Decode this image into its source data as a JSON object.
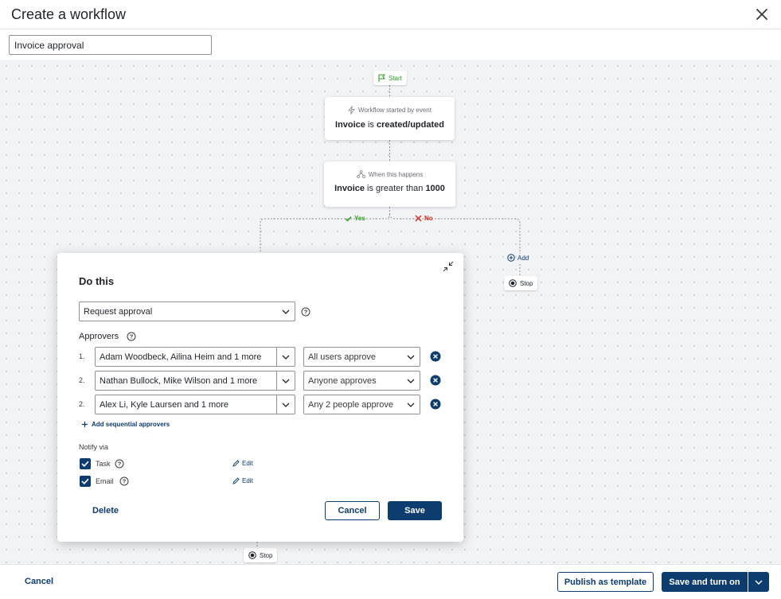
{
  "header": {
    "title": "Create a workflow"
  },
  "workflow_name": {
    "value": "Invoice approval"
  },
  "flow": {
    "start_label": "Start",
    "trigger": {
      "caption": "Workflow started by event",
      "subject": "Invoice",
      "verb": "is",
      "event": "created/updated"
    },
    "condition": {
      "caption": "When this happens",
      "subject": "Invoice",
      "operator": "is greater than",
      "value": "1000"
    },
    "yes_label": "Yes",
    "no_label": "No",
    "add_label": "Add",
    "stop_label": "Stop"
  },
  "panel": {
    "title": "Do this",
    "action": "Request approval",
    "approvers_label": "Approvers",
    "approvers": [
      {
        "num": "1.",
        "names": "Adam Woodbeck, Ailina Heim and 1 more",
        "rule": "All users approve"
      },
      {
        "num": "2.",
        "names": "Nathan Bullock, Mike Wilson and 1 more",
        "rule": "Anyone approves"
      },
      {
        "num": "2.",
        "names": "Alex Li, Kyle Laursen and 1 more",
        "rule": "Any 2 people approve"
      }
    ],
    "add_sequential": "Add sequential approvers",
    "notify_label": "Notify via",
    "notify": [
      {
        "label": "Task",
        "checked": true,
        "edit": "Edit"
      },
      {
        "label": "Email",
        "checked": true,
        "edit": "Edit"
      }
    ],
    "delete": "Delete",
    "cancel": "Cancel",
    "save": "Save"
  },
  "footer": {
    "cancel": "Cancel",
    "publish": "Publish as template",
    "save_on": "Save and turn on"
  },
  "colors": {
    "brand": "#0d3c6e",
    "yes": "#2ca01c",
    "no": "#d52b1e"
  }
}
